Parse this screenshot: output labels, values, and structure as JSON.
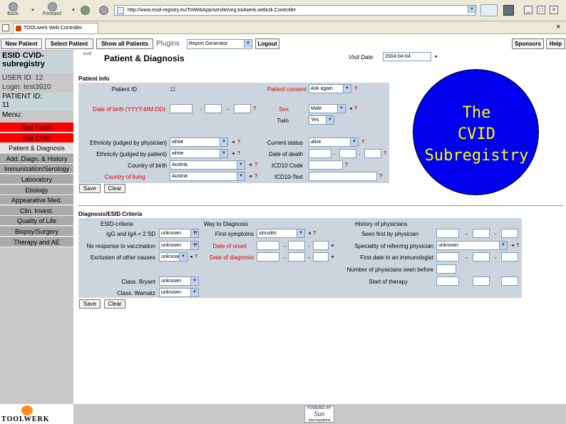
{
  "browser": {
    "back_label": "Back",
    "forward_label": "Forward",
    "address": "http://www.esid-registry.eu/ToWebApp/servlet/org.toolwerk.webctk.Controller",
    "tab_title": "TOOLwerk Web Controller",
    "close_tab": "×",
    "win_min": "_",
    "win_max": "□",
    "win_close": "×"
  },
  "nav": {
    "new_patient": "New Patient",
    "select_patient": "Select Patient",
    "show_all": "Show all Patients",
    "plugins_label": "Plugins",
    "plugin_selected": "Report Generator",
    "logout": "Logout",
    "sponsors": "Sponsors",
    "help": "Help"
  },
  "sidebar": {
    "title": "ESID CVID-subregistry",
    "user_id": "USER ID: 12",
    "login": "Login: test3920",
    "patient_id_label": "PATIENT ID:",
    "patient_id": "11",
    "menu": "Menu:",
    "items": [
      {
        "label": "Red Fields",
        "style": "red"
      },
      {
        "label": "Exit CVID",
        "style": "red"
      },
      {
        "label": "Patient & Diagnosis",
        "style": "active"
      },
      {
        "label": "Add. Diagn. & History",
        "style": "norm"
      },
      {
        "label": "Immunization/Serology",
        "style": "norm"
      },
      {
        "label": "Laboratory",
        "style": "norm"
      },
      {
        "label": "Etiology",
        "style": "norm"
      },
      {
        "label": "Appearative Med.",
        "style": "norm"
      },
      {
        "label": "Clin. Invest.",
        "style": "norm"
      },
      {
        "label": "Quality of Life",
        "style": "norm"
      },
      {
        "label": "Biopsy/Surgery",
        "style": "norm"
      },
      {
        "label": "Therapy and AE",
        "style": "norm"
      }
    ],
    "logo": "TOOLWERK"
  },
  "header": {
    "small_icon": "esid",
    "title": "Patient & Diagnosis",
    "visit_label": "Visit Date:",
    "visit_value": "2004-04-04"
  },
  "patient_info": {
    "section": "Patient Info",
    "patient_id_label": "Patient ID",
    "patient_id_value": "11",
    "consent_label": "Patient consent",
    "consent_value": "Ask again",
    "dob_label": "Date of birth (YYYY-MM-DD)",
    "sex_label": "Sex",
    "sex_value": "Male",
    "twin_label": "Twin",
    "twin_value": "Yes",
    "eth_phys_label": "Ethnicity (judged by physician)",
    "eth_phys_value": "white",
    "eth_pat_label": "Ethnicity (judged by patient)",
    "eth_pat_value": "white",
    "status_label": "Current status",
    "status_value": "alive",
    "dod_label": "Date of death",
    "cob_label": "Country of birth",
    "cob_value": "Austria",
    "icd_label": "ICD10 Code",
    "col_label": "Country of living",
    "col_value": "Austria",
    "icd_text_label": "ICD10-Text",
    "save": "Save",
    "clear": "Clear"
  },
  "diagnosis": {
    "section": "Diagnosis/ESID Criteria",
    "esid_head": "ESID-criteria",
    "igg_label": "IgG and IgA < 2 SD",
    "igg_value": "unknown",
    "novac_label": "No response to vaccination",
    "novac_value": "unknown",
    "excl_label": "Exclusion of other causes",
    "excl_value": "unknown",
    "way_head": "Way to Diagnosis",
    "first_sym_label": "First symptoms",
    "first_sym_value": "sinusitis",
    "onset_label": "Date of onset",
    "diag_label": "Date of diagnosis",
    "hist_head": "History of physicians",
    "seen_label": "Seen first by physician",
    "spec_label": "Speciality of referring physician",
    "spec_value": "unknown",
    "first_imm_label": "First date to an immunologist",
    "num_phys_label": "Number of physicians seen before",
    "start_ther_label": "Start of therapy",
    "bryant_label": "Class. Bryant",
    "bryant_value": "unknown",
    "warnatz_label": "Class. Warnatz",
    "warnatz_value": "unknown",
    "save": "Save",
    "clear": "Clear"
  },
  "badge": {
    "line1": "The",
    "line2": "CVID",
    "line3": "Subregistry"
  },
  "footer": {
    "sun_line1": "POWERED BY",
    "sun_line2": "Sun",
    "sun_line3": "microsystems"
  }
}
